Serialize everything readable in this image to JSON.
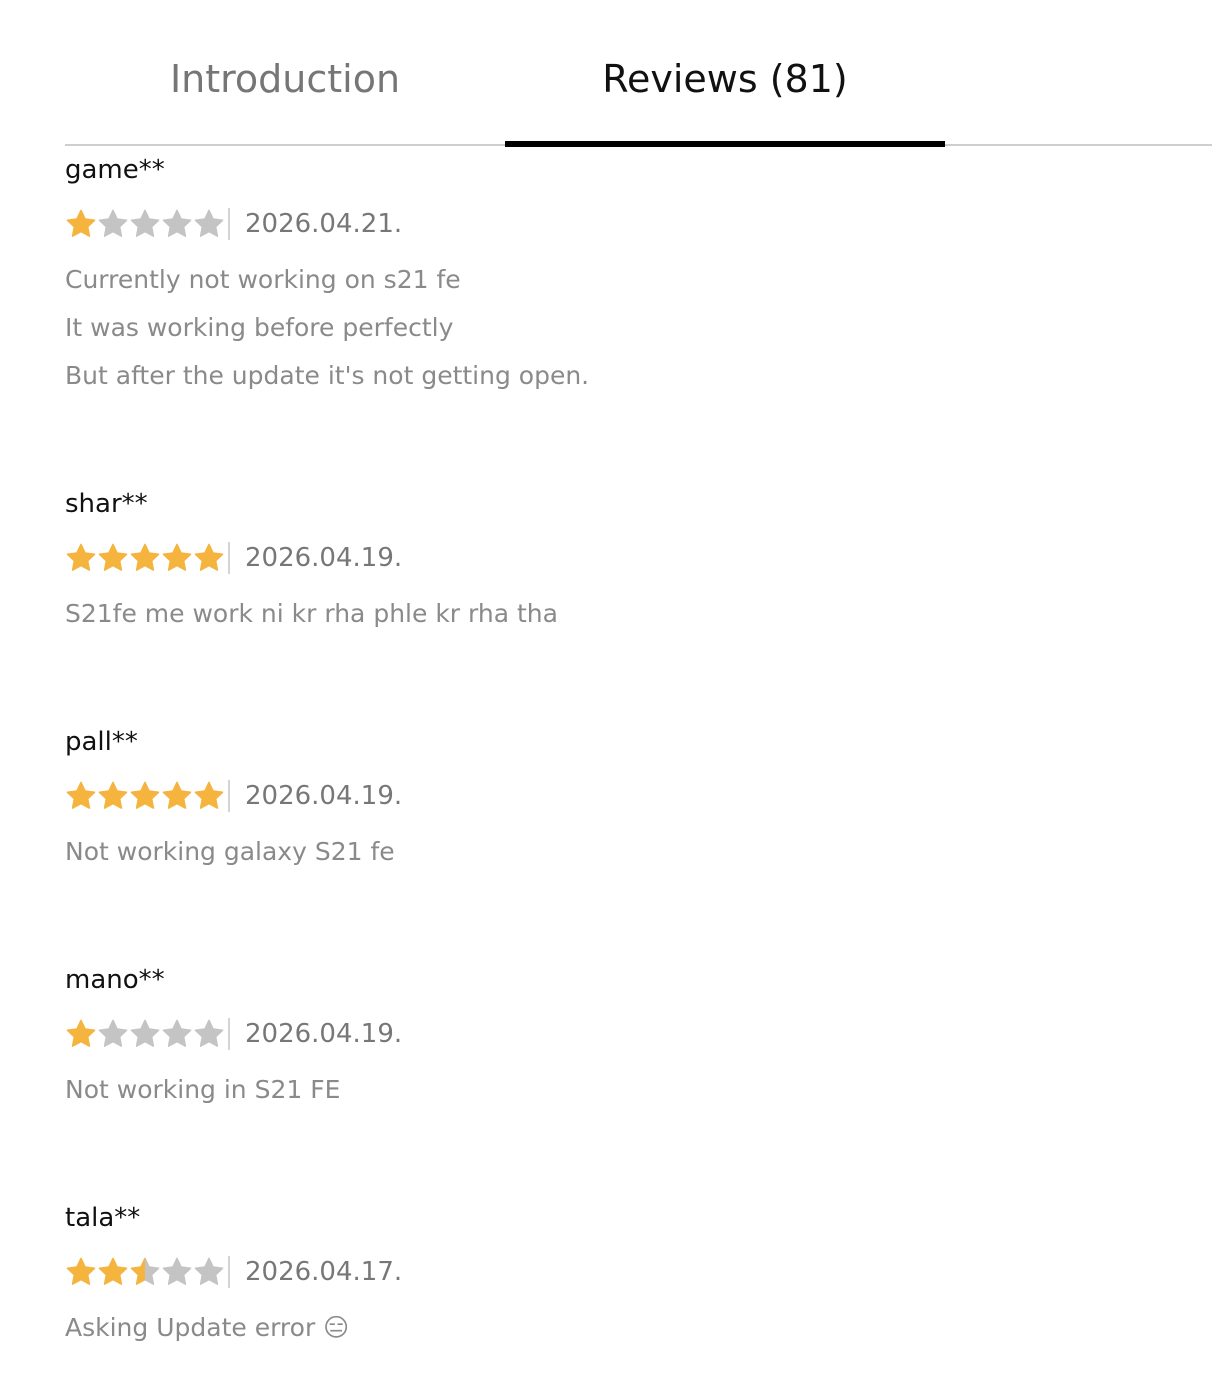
{
  "tabs": {
    "introduction": "Introduction",
    "reviews": "Reviews (81)",
    "active": "reviews"
  },
  "colors": {
    "star_filled": "#f4b43d",
    "star_empty": "#c4c4c4",
    "active_underline": "#000000"
  },
  "reviews": [
    {
      "user": "game**",
      "rating": 1,
      "date": "2026.04.21.",
      "lines": [
        "Currently not working on s21 fe",
        "It was working before perfectly",
        "But after the update it's not getting open."
      ]
    },
    {
      "user": "shar**",
      "rating": 5,
      "date": "2026.04.19.",
      "lines": [
        "S21fe me work ni kr rha phle kr rha tha"
      ]
    },
    {
      "user": "pall**",
      "rating": 5,
      "date": "2026.04.19.",
      "lines": [
        "Not working galaxy S21 fe"
      ]
    },
    {
      "user": "mano**",
      "rating": 1,
      "date": "2026.04.19.",
      "lines": [
        "Not working in S21 FE"
      ]
    },
    {
      "user": "tala**",
      "rating": 2.5,
      "date": "2026.04.17.",
      "lines": [
        "Asking Update error 😑"
      ]
    }
  ]
}
